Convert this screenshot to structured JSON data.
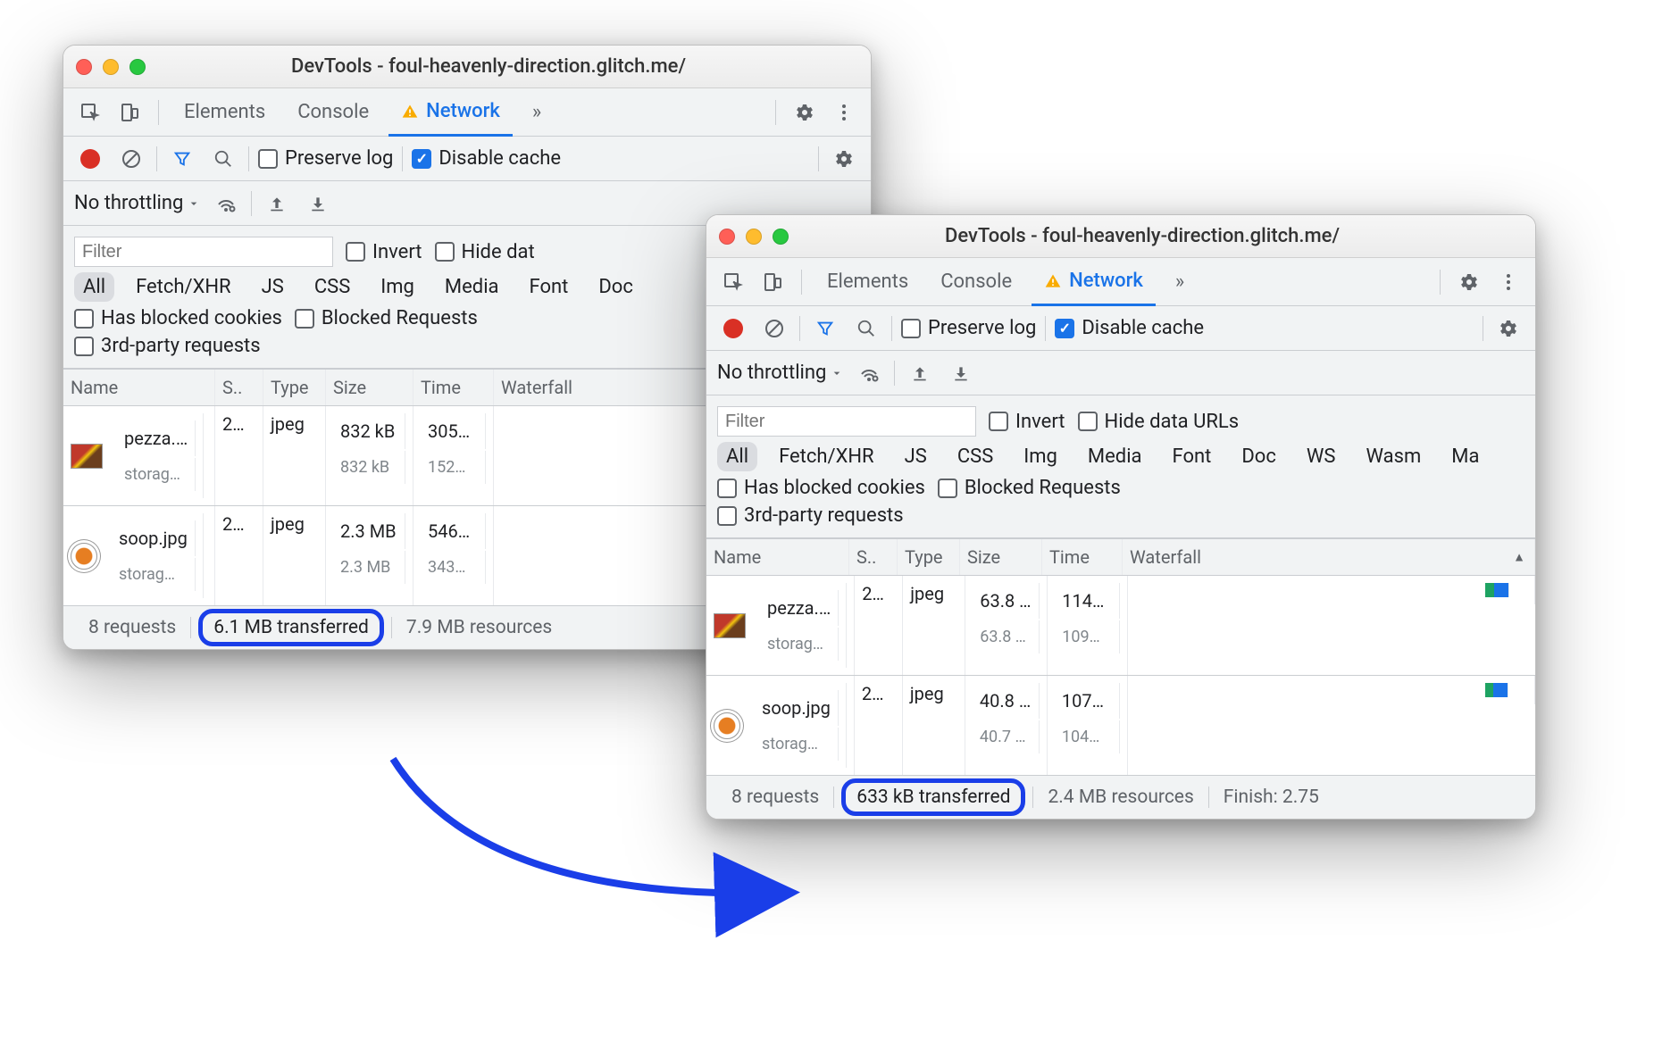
{
  "win1": {
    "title": "DevTools - foul-heavenly-direction.glitch.me/",
    "tabs": [
      "Elements",
      "Console",
      "Network"
    ],
    "activeTab": "Network",
    "more": "»",
    "preserve_log": "Preserve log",
    "disable_cache": "Disable cache",
    "throttling": "No throttling",
    "filter_placeholder": "Filter",
    "invert": "Invert",
    "hide_data": "Hide dat",
    "types": [
      "All",
      "Fetch/XHR",
      "JS",
      "CSS",
      "Img",
      "Media",
      "Font",
      "Doc"
    ],
    "blocked_cookies": "Has blocked cookies",
    "blocked_requests": "Blocked Requests",
    "third_party": "3rd-party requests",
    "headers": [
      "Name",
      "S..",
      "Type",
      "Size",
      "Time",
      "Waterfall"
    ],
    "rows": [
      {
        "name": "pezza.…",
        "domain": "storag…",
        "status": "2…",
        "type": "jpeg",
        "size1": "832 kB",
        "size2": "832 kB",
        "time1": "305…",
        "time2": "152…"
      },
      {
        "name": "soop.jpg",
        "domain": "storag…",
        "status": "2…",
        "type": "jpeg",
        "size1": "2.3 MB",
        "size2": "2.3 MB",
        "time1": "546…",
        "time2": "343…"
      }
    ],
    "status": {
      "requests": "8 requests",
      "transferred": "6.1 MB transferred",
      "resources": "7.9 MB resources"
    }
  },
  "win2": {
    "title": "DevTools - foul-heavenly-direction.glitch.me/",
    "tabs": [
      "Elements",
      "Console",
      "Network"
    ],
    "activeTab": "Network",
    "more": "»",
    "preserve_log": "Preserve log",
    "disable_cache": "Disable cache",
    "throttling": "No throttling",
    "filter_placeholder": "Filter",
    "invert": "Invert",
    "hide_data": "Hide data URLs",
    "types": [
      "All",
      "Fetch/XHR",
      "JS",
      "CSS",
      "Img",
      "Media",
      "Font",
      "Doc",
      "WS",
      "Wasm",
      "Ma"
    ],
    "blocked_cookies": "Has blocked cookies",
    "blocked_requests": "Blocked Requests",
    "third_party": "3rd-party requests",
    "headers": [
      "Name",
      "S..",
      "Type",
      "Size",
      "Time",
      "Waterfall"
    ],
    "rows": [
      {
        "name": "pezza.…",
        "domain": "storag…",
        "status": "2…",
        "type": "jpeg",
        "size1": "63.8 …",
        "size2": "63.8 …",
        "time1": "114…",
        "time2": "109…"
      },
      {
        "name": "soop.jpg",
        "domain": "storag…",
        "status": "2…",
        "type": "jpeg",
        "size1": "40.8 …",
        "size2": "40.7 …",
        "time1": "107…",
        "time2": "104…"
      }
    ],
    "status": {
      "requests": "8 requests",
      "transferred": "633 kB transferred",
      "resources": "2.4 MB resources",
      "finish": "Finish: 2.75"
    }
  }
}
